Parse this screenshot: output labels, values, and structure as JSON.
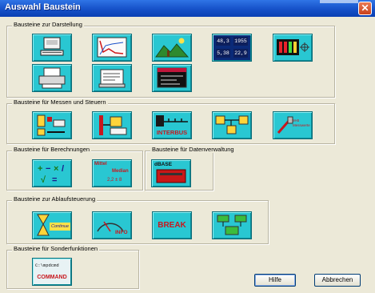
{
  "window": {
    "title": "Auswahl Baustein",
    "close_icon": "close-icon"
  },
  "groups": {
    "darstellung": {
      "label": "Bausteine zur Darstellung"
    },
    "messen": {
      "label": "Bausteine für Messen und Steuern"
    },
    "berechnungen": {
      "label": "Bausteine für Berechnungen"
    },
    "daten": {
      "label": "Bausteine für Datenverwaltung"
    },
    "ablauf": {
      "label": "Bausteine zur Ablaufsteuerung"
    },
    "sonder": {
      "label": "Bausteine für Sonderfunktionen"
    }
  },
  "tiles": {
    "numdisp": {
      "v1": "48,3",
      "v2": "1955",
      "v3": "5,38",
      "v4": "22,9"
    },
    "interbus": {
      "text": "INTERBUS"
    },
    "mess_extra": {
      "text": "M-B Messwerte"
    },
    "formel": {
      "t1": "Mittel",
      "t2": "Median",
      "t3": "2,2 ± 8"
    },
    "db": {
      "text": "dBASE"
    },
    "continue": {
      "text": "Continue"
    },
    "info": {
      "text": "INFO"
    },
    "break": {
      "text": "BREAK"
    },
    "command": {
      "t1": "C:\\mpdcmd",
      "t2": "COMMAND"
    }
  },
  "buttons": {
    "help": "Hilfe",
    "cancel": "Abbrechen"
  },
  "colors": {
    "tile": "#29c7d2",
    "titlebar": "#1651c8"
  }
}
